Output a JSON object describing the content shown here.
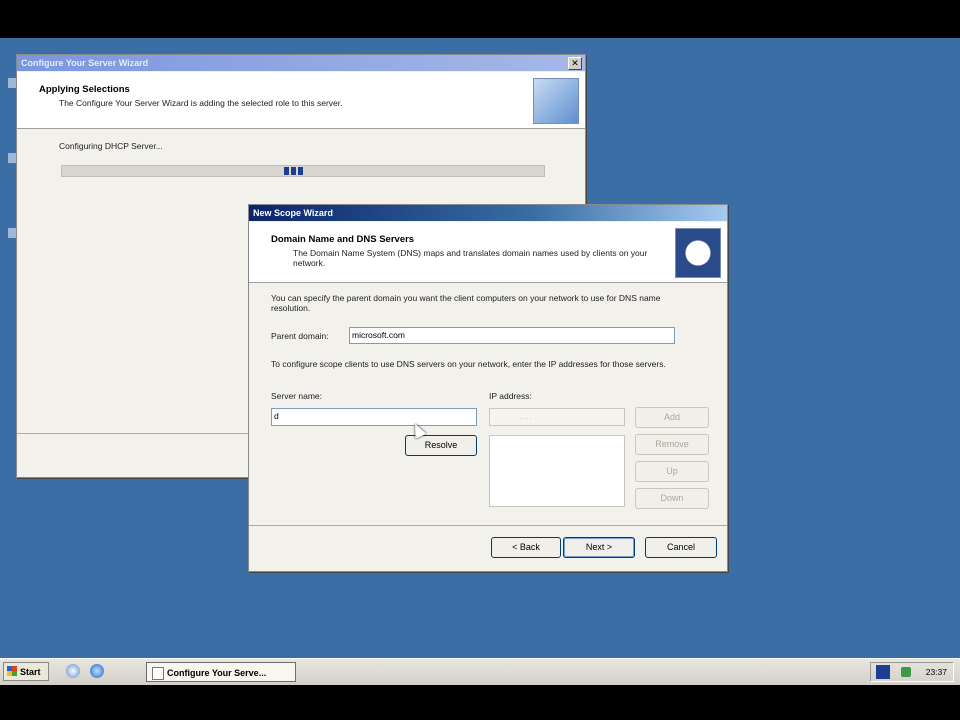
{
  "desktop": {
    "background": "#3a6ea5"
  },
  "wizard_bg": {
    "title": "Configure Your Server Wizard",
    "header_title": "Applying Selections",
    "header_subtitle": "The Configure Your Server Wizard is adding the selected role to this server.",
    "status": "Configuring DHCP Server...",
    "close_glyph": "✕"
  },
  "scope_wizard": {
    "title": "New Scope Wizard",
    "header_title": "Domain Name and DNS Servers",
    "header_subtitle": "The Domain Name System (DNS) maps and translates domain names used by clients on your network.",
    "intro": "You can specify the parent domain you want the client computers on your network to use for DNS name resolution.",
    "parent_domain_label": "Parent domain:",
    "parent_domain_value": "microsoft.com",
    "dns_intro": "To configure scope clients to use DNS servers on your network, enter the IP addresses for those servers.",
    "server_name_label": "Server name:",
    "server_name_value": "d",
    "ip_label": "IP address:",
    "ip_placeholder": ".       .       .",
    "resolve": "Resolve",
    "add": "Add",
    "remove": "Remove",
    "up": "Up",
    "down": "Down",
    "back": "< Back",
    "next": "Next >",
    "cancel": "Cancel"
  },
  "taskbar": {
    "start": "Start",
    "task": "Configure Your Serve...",
    "time": "23:37"
  }
}
